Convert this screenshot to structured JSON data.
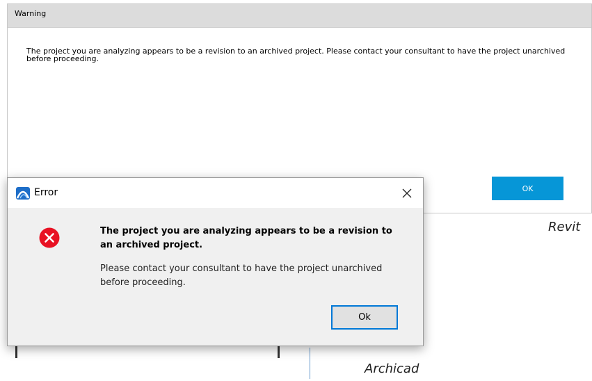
{
  "revit": {
    "title": "Warning",
    "message": "The project you are analyzing appears to be a revision to an archived project.  Please contact your consultant to have the project unarchived before proceeding.",
    "ok_label": "OK",
    "caption": "Revit",
    "accent_color": "#0696d7"
  },
  "archicad": {
    "title": "Error",
    "app_icon": "archicad-logo-icon",
    "close_icon": "close-icon",
    "error_icon": "error-x-icon",
    "heading": "The project you are analyzing appears to be a revision to an archived project.",
    "body": "Please contact your consultant to have the project unarchived before proceeding.",
    "ok_label": "Ok",
    "caption": "Archicad",
    "error_color": "#e81123"
  }
}
